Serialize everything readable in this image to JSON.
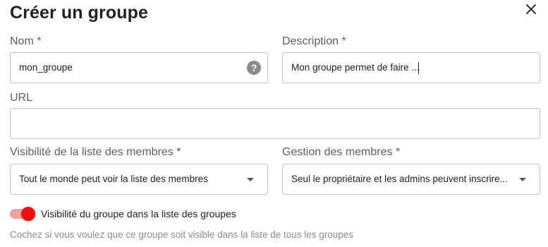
{
  "dialog": {
    "title": "Créer un groupe",
    "close_icon": "close-icon"
  },
  "fields": {
    "name": {
      "label": "Nom *",
      "value": "mon_groupe",
      "help_icon": "help-icon",
      "help_glyph": "?"
    },
    "description": {
      "label": "Description *",
      "value": "Mon groupe permet de faire ..."
    },
    "url": {
      "label": "URL",
      "value": ""
    },
    "member_list_visibility": {
      "label": "Visibilité de la liste des membres *",
      "value": "Tout le monde peut voir la liste des membres"
    },
    "member_management": {
      "label": "Gestion des membres *",
      "value": "Seul le propriétaire et les admins peuvent inscrire..."
    }
  },
  "visibility_toggle": {
    "label": "Visibilité du groupe dans la liste des groupes",
    "checked": true,
    "hint": "Cochez si vous voulez que ce groupe soit visible dans la liste de tous les groupes",
    "accent_color": "#ee1111",
    "track_color": "#f5a0a0"
  }
}
